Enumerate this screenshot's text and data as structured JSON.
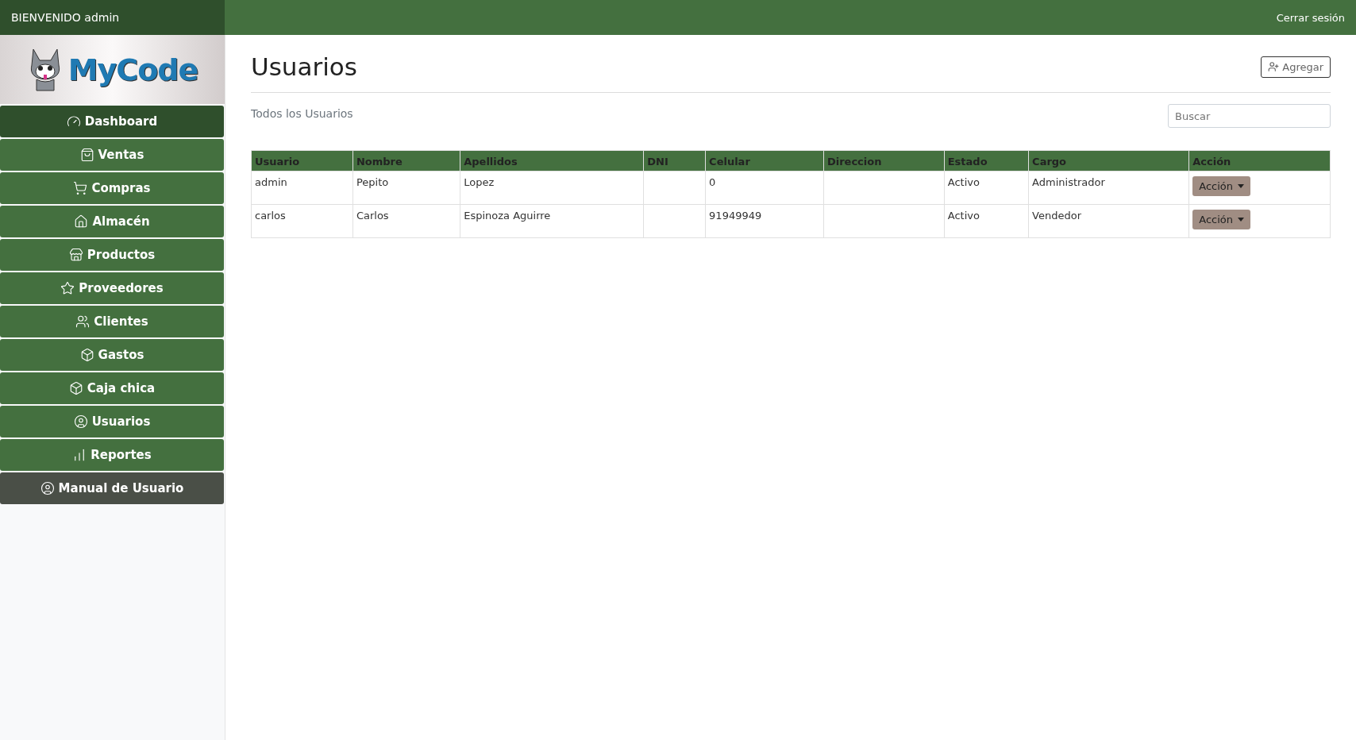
{
  "header": {
    "welcome": "BIENVENIDO admin",
    "logout": "Cerrar sesión"
  },
  "logo": {
    "text": "MyCode"
  },
  "sidebar": {
    "items": [
      {
        "label": "Dashboard",
        "kind": "nav",
        "selected": true
      },
      {
        "label": "Ventas",
        "kind": "nav",
        "selected": false
      },
      {
        "label": "Compras",
        "kind": "nav",
        "selected": false
      },
      {
        "label": "Almacén",
        "kind": "nav",
        "selected": false
      },
      {
        "label": "Productos",
        "kind": "nav",
        "selected": false
      },
      {
        "label": "Proveedores",
        "kind": "nav",
        "selected": false
      },
      {
        "label": "Clientes",
        "kind": "nav",
        "selected": false
      },
      {
        "label": "Gastos",
        "kind": "nav",
        "selected": false
      },
      {
        "label": "Caja chica",
        "kind": "nav",
        "selected": false
      },
      {
        "label": "Usuarios",
        "kind": "nav",
        "selected": false
      },
      {
        "label": "Reportes",
        "kind": "nav",
        "selected": false
      },
      {
        "label": "Manual de Usuario",
        "kind": "manual",
        "selected": false
      }
    ]
  },
  "page": {
    "title": "Usuarios",
    "add_button": "Agregar",
    "subtitle": "Todos los Usuarios",
    "search": {
      "placeholder": "Buscar"
    }
  },
  "table": {
    "columns": [
      "Usuario",
      "Nombre",
      "Apellidos",
      "DNI",
      "Celular",
      "Direccion",
      "Estado",
      "Cargo",
      "Acción"
    ],
    "rows": [
      {
        "cells": [
          "admin",
          "Pepito",
          "Lopez",
          "",
          "0",
          "",
          "Activo",
          "Administrador"
        ],
        "action": "Acción"
      },
      {
        "cells": [
          "carlos",
          "Carlos",
          "Espinoza Aguirre",
          "",
          "91949949",
          "",
          "Activo",
          "Vendedor"
        ],
        "action": "Acción"
      }
    ]
  }
}
